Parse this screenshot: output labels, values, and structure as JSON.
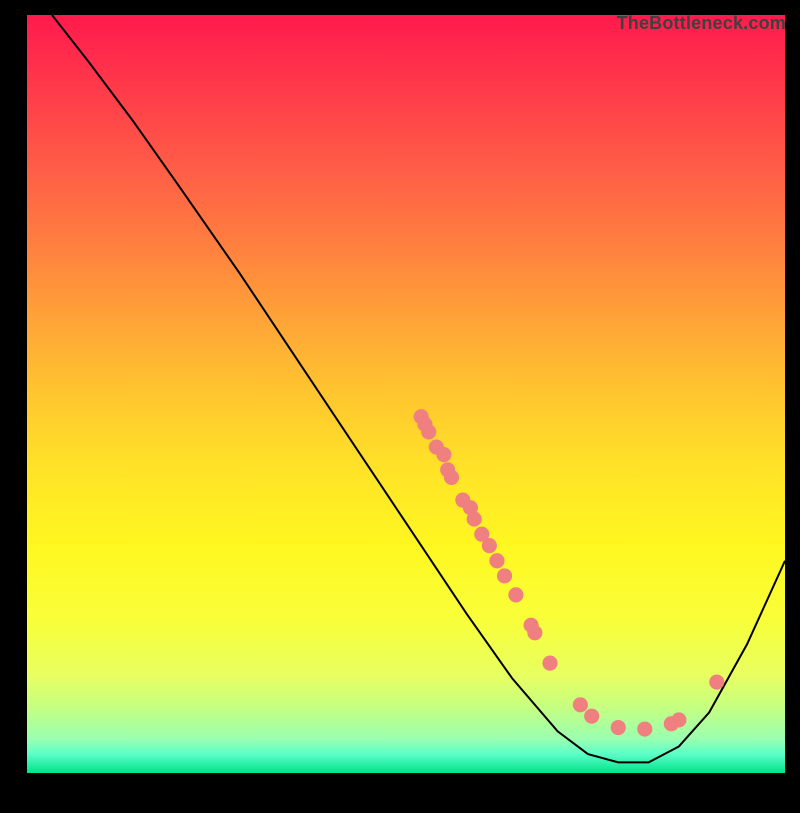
{
  "watermark": "TheBottleneck.com",
  "chart_data": {
    "type": "line",
    "title": "",
    "xlabel": "",
    "ylabel": "",
    "xlim": [
      0,
      100
    ],
    "ylim": [
      0,
      100
    ],
    "curve": [
      {
        "x": 3.3,
        "y": 100
      },
      {
        "x": 8,
        "y": 94
      },
      {
        "x": 14,
        "y": 86
      },
      {
        "x": 20,
        "y": 77.5
      },
      {
        "x": 28,
        "y": 66
      },
      {
        "x": 36,
        "y": 54
      },
      {
        "x": 44,
        "y": 42
      },
      {
        "x": 52,
        "y": 30
      },
      {
        "x": 58,
        "y": 21
      },
      {
        "x": 64,
        "y": 12.5
      },
      {
        "x": 70,
        "y": 5.5
      },
      {
        "x": 74,
        "y": 2.5
      },
      {
        "x": 78,
        "y": 1.4
      },
      {
        "x": 82,
        "y": 1.4
      },
      {
        "x": 86,
        "y": 3.5
      },
      {
        "x": 90,
        "y": 8
      },
      {
        "x": 95,
        "y": 17
      },
      {
        "x": 100,
        "y": 28
      }
    ],
    "markers": [
      {
        "x": 52,
        "y": 47
      },
      {
        "x": 52.5,
        "y": 46
      },
      {
        "x": 53,
        "y": 45
      },
      {
        "x": 54,
        "y": 43
      },
      {
        "x": 55,
        "y": 42
      },
      {
        "x": 55.5,
        "y": 40
      },
      {
        "x": 56,
        "y": 39
      },
      {
        "x": 57.5,
        "y": 36
      },
      {
        "x": 58.5,
        "y": 35
      },
      {
        "x": 59,
        "y": 33.5
      },
      {
        "x": 60,
        "y": 31.5
      },
      {
        "x": 61,
        "y": 30
      },
      {
        "x": 62,
        "y": 28
      },
      {
        "x": 63,
        "y": 26
      },
      {
        "x": 64.5,
        "y": 23.5
      },
      {
        "x": 66.5,
        "y": 19.5
      },
      {
        "x": 67,
        "y": 18.5
      },
      {
        "x": 69,
        "y": 14.5
      },
      {
        "x": 73,
        "y": 9
      },
      {
        "x": 74.5,
        "y": 7.5
      },
      {
        "x": 78,
        "y": 6
      },
      {
        "x": 81.5,
        "y": 5.8
      },
      {
        "x": 85,
        "y": 6.5
      },
      {
        "x": 86,
        "y": 7
      },
      {
        "x": 91,
        "y": 12
      }
    ],
    "marker_color": "#f08080",
    "curve_color": "#000000"
  }
}
